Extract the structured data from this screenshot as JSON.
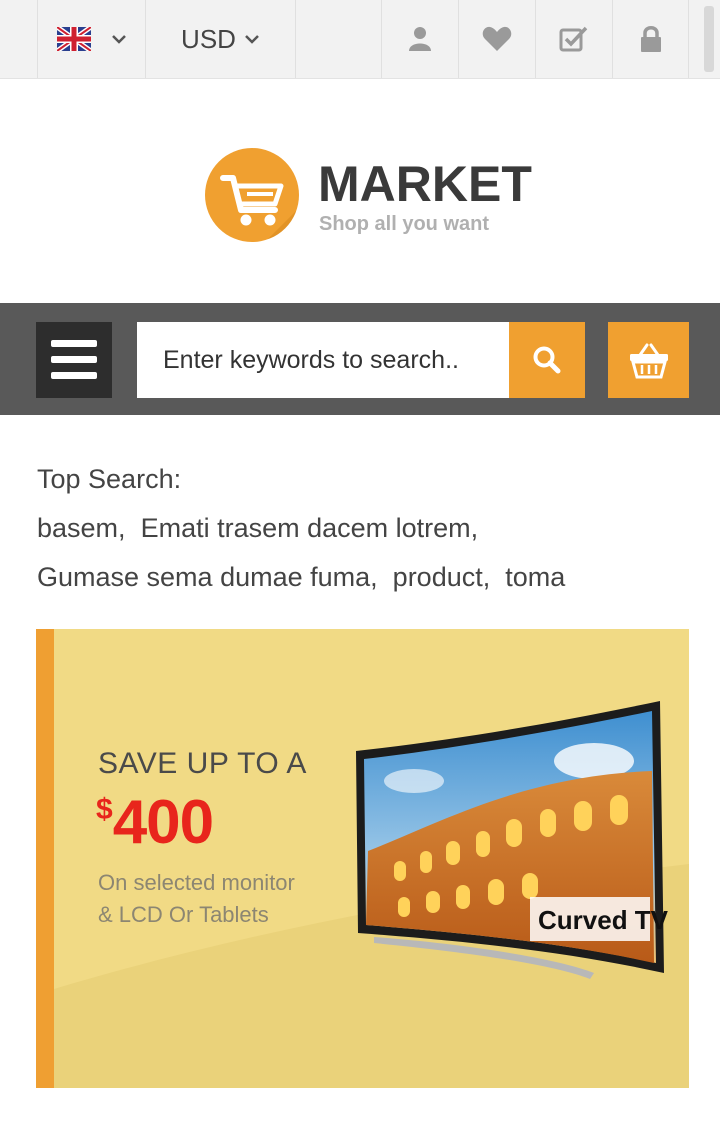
{
  "topbar": {
    "language_icon": "uk-flag-icon",
    "currency": "USD",
    "icons": [
      "user-icon",
      "heart-icon",
      "checkbox-icon",
      "lock-icon"
    ]
  },
  "logo": {
    "title": "MARKET",
    "tagline": "Shop all you want"
  },
  "search": {
    "placeholder": "Enter keywords to search.."
  },
  "top_search": {
    "heading": "Top Search:",
    "terms": [
      "basem",
      "Emati trasem dacem lotrem",
      "Gumase sema dumae fuma",
      "product",
      "toma"
    ]
  },
  "banner": {
    "headline": "SAVE UP TO A",
    "currency_symbol": "$",
    "amount": "400",
    "subtitle_line1": "On selected monitor",
    "subtitle_line2": "& LCD Or Tablets",
    "product_label": "Curved TV"
  },
  "colors": {
    "accent": "#f0a030",
    "searchbar_bg": "#595959",
    "banner_bg": "#f1da85",
    "price_red": "#e8251c"
  }
}
